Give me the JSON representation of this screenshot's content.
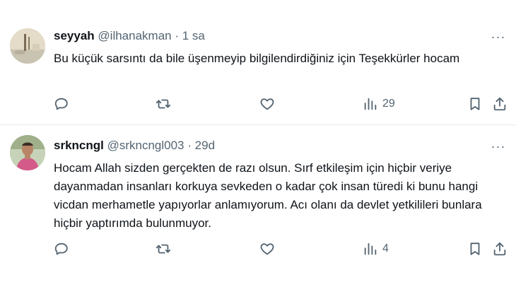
{
  "tweets": [
    {
      "name": "seyyah",
      "handle": "@ilhanakman",
      "dot": "·",
      "time": "1 sa",
      "text": "Bu küçük sarsıntı da bile üşenmeyip bilgilendirdiğiniz için Teşekkürler hocam",
      "views": "29",
      "more": "···"
    },
    {
      "name": "srkncngl",
      "handle": "@srkncngl003",
      "dot": "·",
      "time": "29d",
      "text": "Hocam Allah sizden gerçekten de razı olsun. Sırf etkileşim için hiçbir veriye dayanmadan insanları korkuya sevkeden o kadar çok insan türedi ki bunu hangi vicdan merhametle yapıyorlar anlamıyorum. Acı olanı da devlet yetkilileri bunlara hiçbir yaptırımda bulunmuyor.",
      "views": "4",
      "more": "···"
    }
  ],
  "icons": {
    "reply": "reply-icon",
    "retweet": "retweet-icon",
    "like": "like-icon",
    "views": "views-icon",
    "bookmark": "bookmark-icon",
    "share": "share-icon"
  },
  "colors": {
    "text": "#0f1419",
    "secondary": "#536471",
    "divider": "#e6e9ec"
  }
}
